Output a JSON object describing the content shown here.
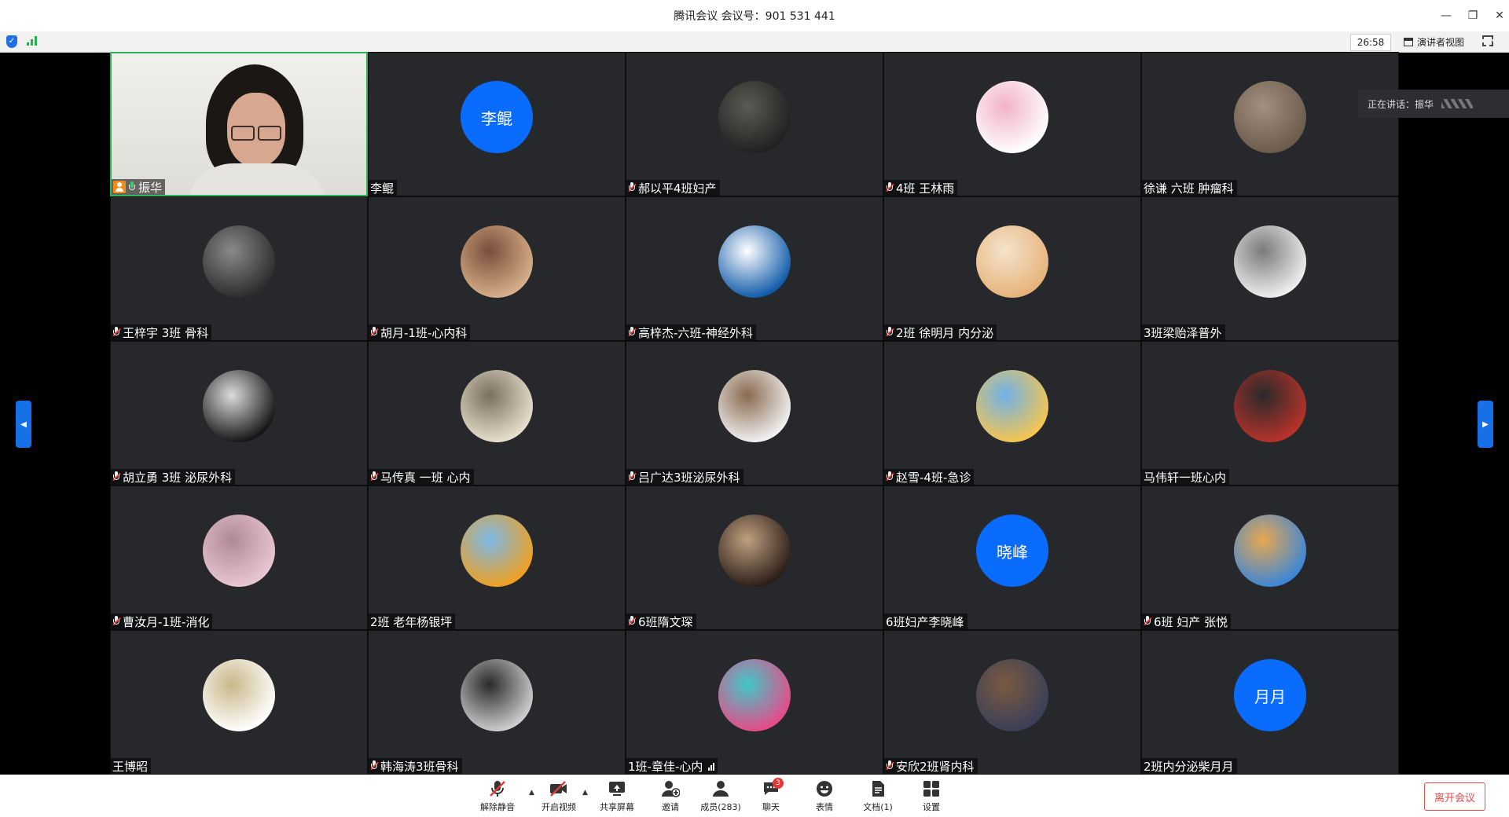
{
  "window": {
    "title": "腾讯会议 会议号：901 531 441",
    "controls": [
      "—",
      "❐",
      "✕"
    ]
  },
  "status": {
    "timer": "26:58",
    "view_label": "演讲者视图"
  },
  "speaking_label": "正在讲话：振华",
  "participants": [
    {
      "name": "振华",
      "type": "camera",
      "mic": "on",
      "host": true
    },
    {
      "name": "李鲲",
      "type": "text",
      "avatar_text": "李鲲",
      "mic": "none"
    },
    {
      "name": "郝以平4班妇产",
      "type": "image",
      "mic": "muted",
      "colors": [
        "#202020",
        "#5b5b55"
      ]
    },
    {
      "name": "4班 王林雨",
      "type": "image",
      "mic": "muted",
      "colors": [
        "#ffffff",
        "#f2b2c8"
      ]
    },
    {
      "name": "徐谦 六班 肿瘤科",
      "type": "image",
      "mic": "none",
      "colors": [
        "#6b5b4a",
        "#a29080"
      ]
    },
    {
      "name": "王梓宇 3班 骨科",
      "type": "image",
      "mic": "muted",
      "colors": [
        "#2c2c2c",
        "#8a8a8a"
      ]
    },
    {
      "name": "胡月-1班-心内科",
      "type": "image",
      "mic": "muted",
      "colors": [
        "#d8b08a",
        "#7a4e3a"
      ]
    },
    {
      "name": "高梓杰-六班-神经外科",
      "type": "image",
      "mic": "muted",
      "colors": [
        "#0f5aa8",
        "#ffffff"
      ]
    },
    {
      "name": "2班 徐明月 内分泌",
      "type": "image",
      "mic": "muted",
      "colors": [
        "#e6b37a",
        "#f4e3cc"
      ]
    },
    {
      "name": "3班梁贻泽普外",
      "type": "image",
      "mic": "none",
      "colors": [
        "#efefef",
        "#7a7a7a"
      ]
    },
    {
      "name": "胡立勇 3班 泌尿外科",
      "type": "image",
      "mic": "muted",
      "colors": [
        "#151515",
        "#dcdcdc"
      ]
    },
    {
      "name": "马传真 一班 心内",
      "type": "image",
      "mic": "muted",
      "colors": [
        "#e8e0cc",
        "#7a6f60"
      ]
    },
    {
      "name": "吕广达3班泌尿外科",
      "type": "image",
      "mic": "muted",
      "colors": [
        "#f2f2f2",
        "#8a6a50"
      ]
    },
    {
      "name": "赵雪-4班-急诊",
      "type": "image",
      "mic": "muted",
      "colors": [
        "#f5c550",
        "#6fb2e8"
      ]
    },
    {
      "name": "马伟轩一班心内",
      "type": "image",
      "mic": "none",
      "colors": [
        "#b8322a",
        "#2a2a2a"
      ]
    },
    {
      "name": "曹汝月-1班-消化",
      "type": "image",
      "mic": "muted",
      "colors": [
        "#e8c8d0",
        "#b08898"
      ]
    },
    {
      "name": "2班 老年杨银坪",
      "type": "image",
      "mic": "none",
      "colors": [
        "#f0a020",
        "#7ab8e8"
      ]
    },
    {
      "name": " 6班隋文琛",
      "type": "image",
      "mic": "muted",
      "colors": [
        "#2b1e18",
        "#c0a080"
      ]
    },
    {
      "name": "6班妇产李晓峰",
      "type": "text",
      "avatar_text": "晓峰",
      "mic": "none"
    },
    {
      "name": "6班 妇产 张悦",
      "type": "image",
      "mic": "muted",
      "colors": [
        "#3a86d8",
        "#e8a850"
      ]
    },
    {
      "name": "王博昭",
      "type": "image",
      "mic": "none",
      "colors": [
        "#ffffff",
        "#c8b88a"
      ]
    },
    {
      "name": "韩海涛3班骨科",
      "type": "image",
      "mic": "muted",
      "colors": [
        "#cfcfcf",
        "#2a2a2a"
      ]
    },
    {
      "name": "1班-章佳-心内",
      "type": "image",
      "mic": "none",
      "bars": true,
      "colors": [
        "#e84a88",
        "#40c8c8"
      ]
    },
    {
      "name": "安欣2班肾内科",
      "type": "image",
      "mic": "muted",
      "colors": [
        "#3a3f58",
        "#7a5a40"
      ]
    },
    {
      "name": "2班内分泌柴月月",
      "type": "text",
      "avatar_text": "月月",
      "mic": "none"
    }
  ],
  "toolbar": {
    "items": [
      {
        "label": "解除静音",
        "icon": "mic-muted-icon",
        "caret": true
      },
      {
        "label": "开启视频",
        "icon": "video-off-icon",
        "caret": true
      },
      {
        "label": "共享屏幕",
        "icon": "share-screen-icon"
      },
      {
        "label": "邀请",
        "icon": "invite-icon"
      },
      {
        "label": "成员(283)",
        "icon": "members-icon"
      },
      {
        "label": "聊天",
        "icon": "chat-icon",
        "badge": "3"
      },
      {
        "label": "表情",
        "icon": "emoji-icon"
      },
      {
        "label": "文档(1)",
        "icon": "document-icon"
      },
      {
        "label": "设置",
        "icon": "settings-icon"
      }
    ],
    "leave_label": "离开会议"
  },
  "colors": {
    "tile_bg": "#26282c",
    "accent_blue": "#0a6cff",
    "active_border": "#2db55d",
    "leave_red": "#e24c4c"
  }
}
